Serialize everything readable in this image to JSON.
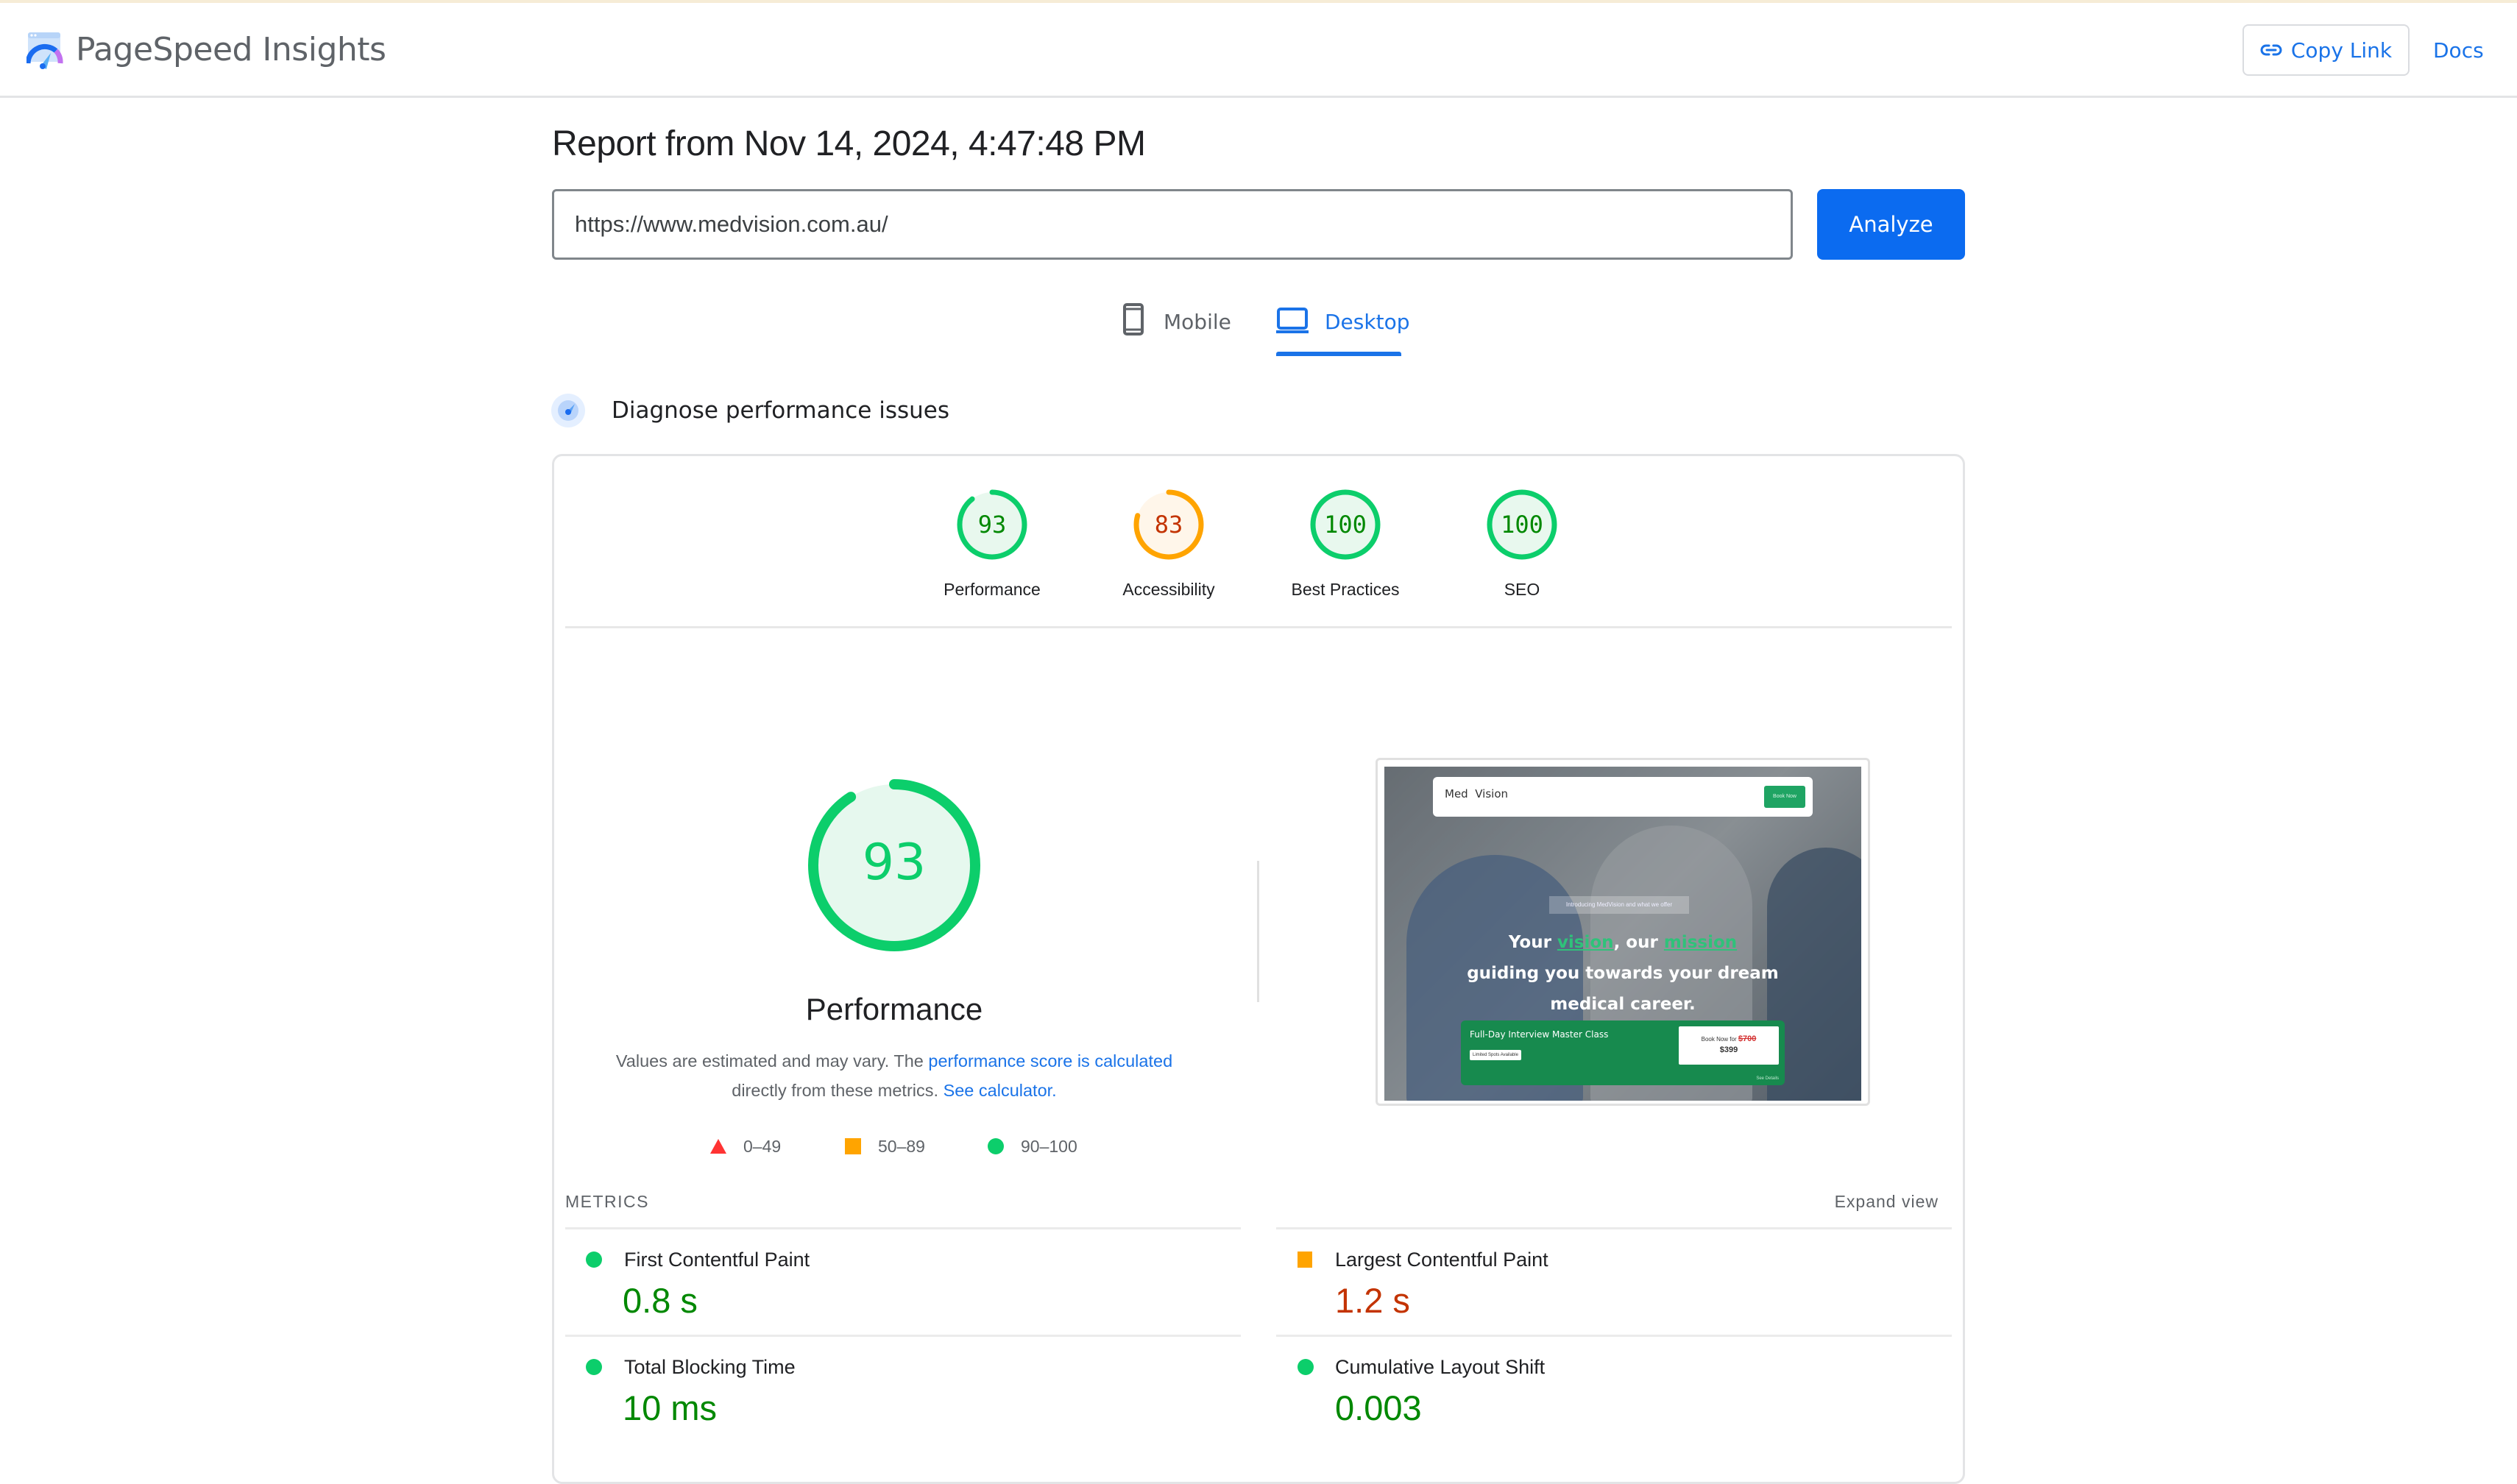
{
  "header": {
    "app_title": "PageSpeed Insights",
    "copy_link_label": "Copy Link",
    "docs_label": "Docs"
  },
  "report": {
    "title": "Report from Nov 14, 2024, 4:47:48 PM",
    "url_value": "https://www.medvision.com.au/",
    "analyze_label": "Analyze"
  },
  "tabs": [
    {
      "label": "Mobile",
      "icon": "smartphone-icon",
      "active": false
    },
    {
      "label": "Desktop",
      "icon": "laptop-icon",
      "active": true
    }
  ],
  "diagnose": {
    "title": "Diagnose performance issues"
  },
  "scores": [
    {
      "label": "Performance",
      "value": 93,
      "rating": "pass"
    },
    {
      "label": "Accessibility",
      "value": 83,
      "rating": "average"
    },
    {
      "label": "Best Practices",
      "value": 100,
      "rating": "pass"
    },
    {
      "label": "SEO",
      "value": 100,
      "rating": "pass"
    }
  ],
  "performance": {
    "score": 93,
    "title": "Performance",
    "desc_prefix": "Values are estimated and may vary. The ",
    "desc_link1": "performance score is calculated",
    "desc_mid": " directly from these metrics. ",
    "desc_link2": "See calculator."
  },
  "legend": [
    {
      "range": "0–49",
      "shape": "triangle",
      "color": "#ff3333"
    },
    {
      "range": "50–89",
      "shape": "square",
      "color": "#ffa400"
    },
    {
      "range": "90–100",
      "shape": "circle",
      "color": "#0cce6b"
    }
  ],
  "screenshot": {
    "logo": "Med Vision",
    "book_button": "Book Now",
    "intro": "Introducing MedVision and what we offer",
    "headline_1a": "Your ",
    "headline_1b": "vision",
    "headline_1c": ", our ",
    "headline_1d": "mission",
    "headline_2": "guiding you towards your dream",
    "headline_3": "medical career.",
    "cta_title": "Full-Day Interview Master Class",
    "cta_tag": "Limited Spots Available",
    "cta_price_prefix": "Book Now for ",
    "cta_old_price": "$700",
    "cta_new_price": "$399",
    "cta_details": "See Details"
  },
  "metrics": {
    "section_label": "METRICS",
    "expand_label": "Expand view",
    "items": [
      {
        "name": "First Contentful Paint",
        "value": "0.8 s",
        "rating": "pass"
      },
      {
        "name": "Largest Contentful Paint",
        "value": "1.2 s",
        "rating": "average"
      },
      {
        "name": "Total Blocking Time",
        "value": "10 ms",
        "rating": "pass"
      },
      {
        "name": "Cumulative Layout Shift",
        "value": "0.003",
        "rating": "pass"
      }
    ]
  },
  "colors": {
    "pass": "#0cce6b",
    "pass_text": "#008800",
    "average": "#ffa400",
    "average_text": "#c33300",
    "fail": "#ff3333",
    "accent": "#1a73e8",
    "analyze_bg": "#0b6bf0"
  }
}
